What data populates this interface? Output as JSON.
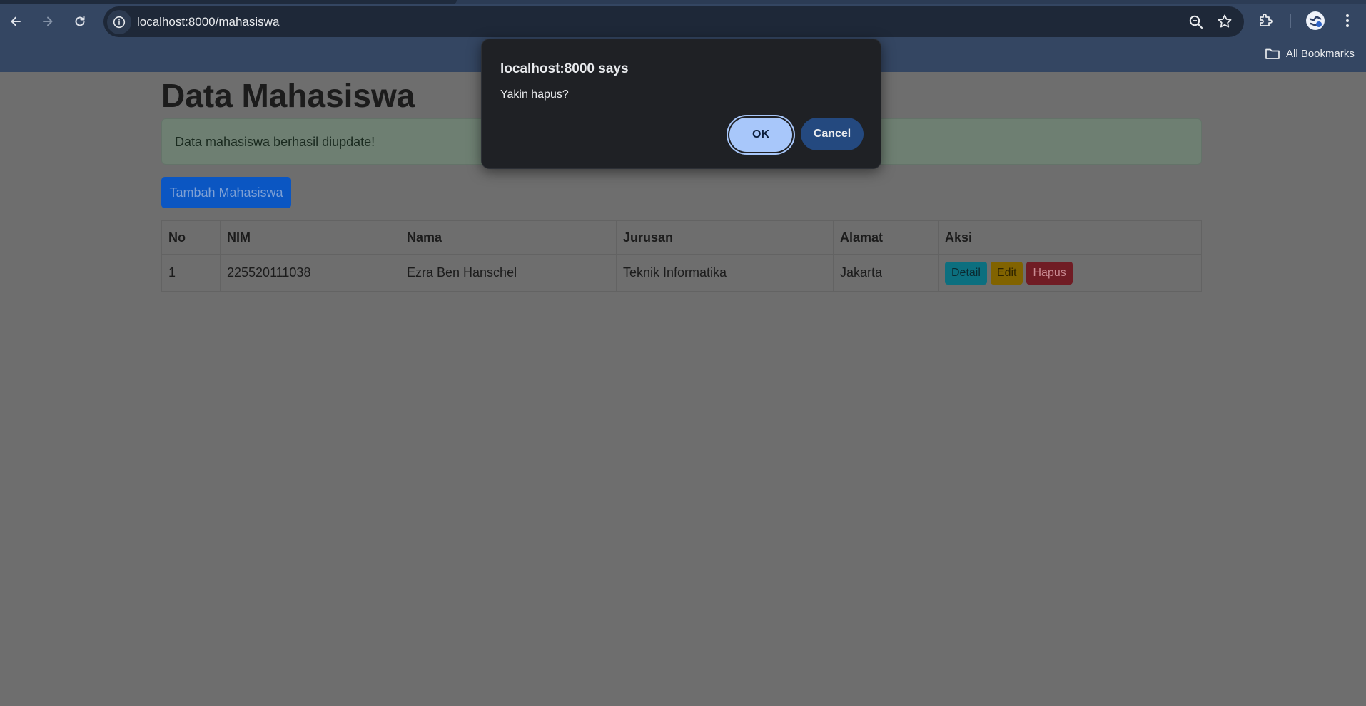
{
  "browser": {
    "url": "localhost:8000/mahasiswa",
    "bookmarks_label": "All Bookmarks"
  },
  "page": {
    "title": "Data Mahasiswa",
    "alert_text": "Data mahasiswa berhasil diupdate!",
    "add_button": "Tambah Mahasiswa",
    "table": {
      "headers": [
        "No",
        "NIM",
        "Nama",
        "Jurusan",
        "Alamat",
        "Aksi"
      ],
      "rows": [
        {
          "no": "1",
          "nim": "225520111038",
          "nama": "Ezra Ben Hanschel",
          "jurusan": "Teknik Informatika",
          "alamat": "Jakarta"
        }
      ],
      "actions": {
        "detail": "Detail",
        "edit": "Edit",
        "hapus": "Hapus"
      }
    }
  },
  "dialog": {
    "title": "localhost:8000 says",
    "message": "Yakin hapus?",
    "ok_label": "OK",
    "cancel_label": "Cancel"
  }
}
